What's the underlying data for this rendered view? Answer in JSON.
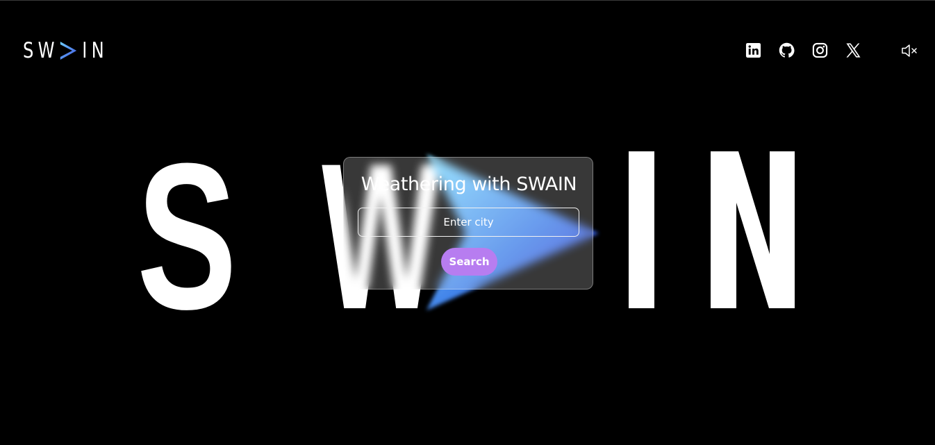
{
  "brand": {
    "logo_text": {
      "part1": "SW",
      "part2": "IN"
    },
    "logo_accent_colors": [
      "#4fc3f7",
      "#3f51e0"
    ]
  },
  "nav": {
    "social_links": [
      {
        "name": "linkedin",
        "icon": "linkedin-icon"
      },
      {
        "name": "github",
        "icon": "github-icon"
      },
      {
        "name": "instagram",
        "icon": "instagram-icon"
      },
      {
        "name": "x",
        "icon": "x-icon"
      }
    ],
    "sound_toggle": {
      "icon": "speaker-muted-icon",
      "state": "muted"
    }
  },
  "hero": {
    "background_word": {
      "part1": "S W",
      "part2": "I N"
    }
  },
  "weather_card": {
    "title": "Weathering with SWAIN",
    "city_input": {
      "placeholder": "Enter city",
      "value": ""
    },
    "search_label": "Search"
  },
  "colors": {
    "background": "#000000",
    "text": "#ffffff",
    "button": "#b77df0",
    "card": "rgba(255,255,255,0.22)"
  }
}
